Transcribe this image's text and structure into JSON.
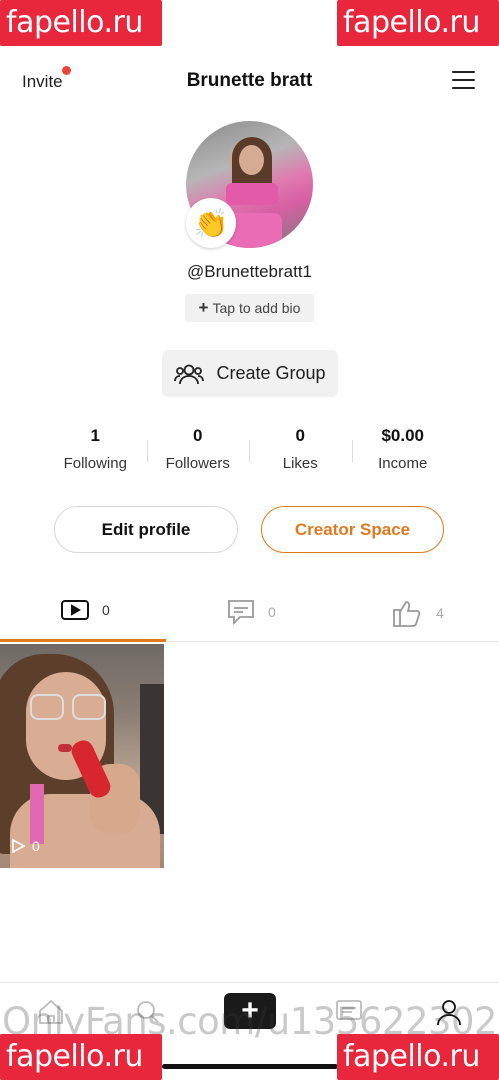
{
  "watermarks": {
    "site": "fapello.ru",
    "source": "OnlyFans.com/u135622302"
  },
  "header": {
    "invite_label": "Invite",
    "title": "Brunette bratt"
  },
  "profile": {
    "handle": "@Brunettebratt1",
    "bio_placeholder": "Tap to add bio",
    "badge_emoji": "👏",
    "create_group_label": "Create Group"
  },
  "stats": [
    {
      "value": "1",
      "label": "Following"
    },
    {
      "value": "0",
      "label": "Followers"
    },
    {
      "value": "0",
      "label": "Likes"
    },
    {
      "value": "$0.00",
      "label": "Income"
    }
  ],
  "actions": {
    "edit_profile": "Edit profile",
    "creator_space": "Creator Space"
  },
  "tabs": [
    {
      "icon": "video-icon",
      "count": "0"
    },
    {
      "icon": "comment-icon",
      "count": "0"
    },
    {
      "icon": "thumbs-up-icon",
      "count": "4"
    }
  ],
  "videos": [
    {
      "play_count": "0"
    }
  ],
  "colors": {
    "accent": "#e07a20",
    "watermark": "#e8273d",
    "notification_dot": "#e8453c"
  },
  "bottom_nav": [
    {
      "icon": "home-icon"
    },
    {
      "icon": "search-icon"
    },
    {
      "icon": "plus-icon"
    },
    {
      "icon": "messages-icon"
    },
    {
      "icon": "profile-icon"
    }
  ]
}
